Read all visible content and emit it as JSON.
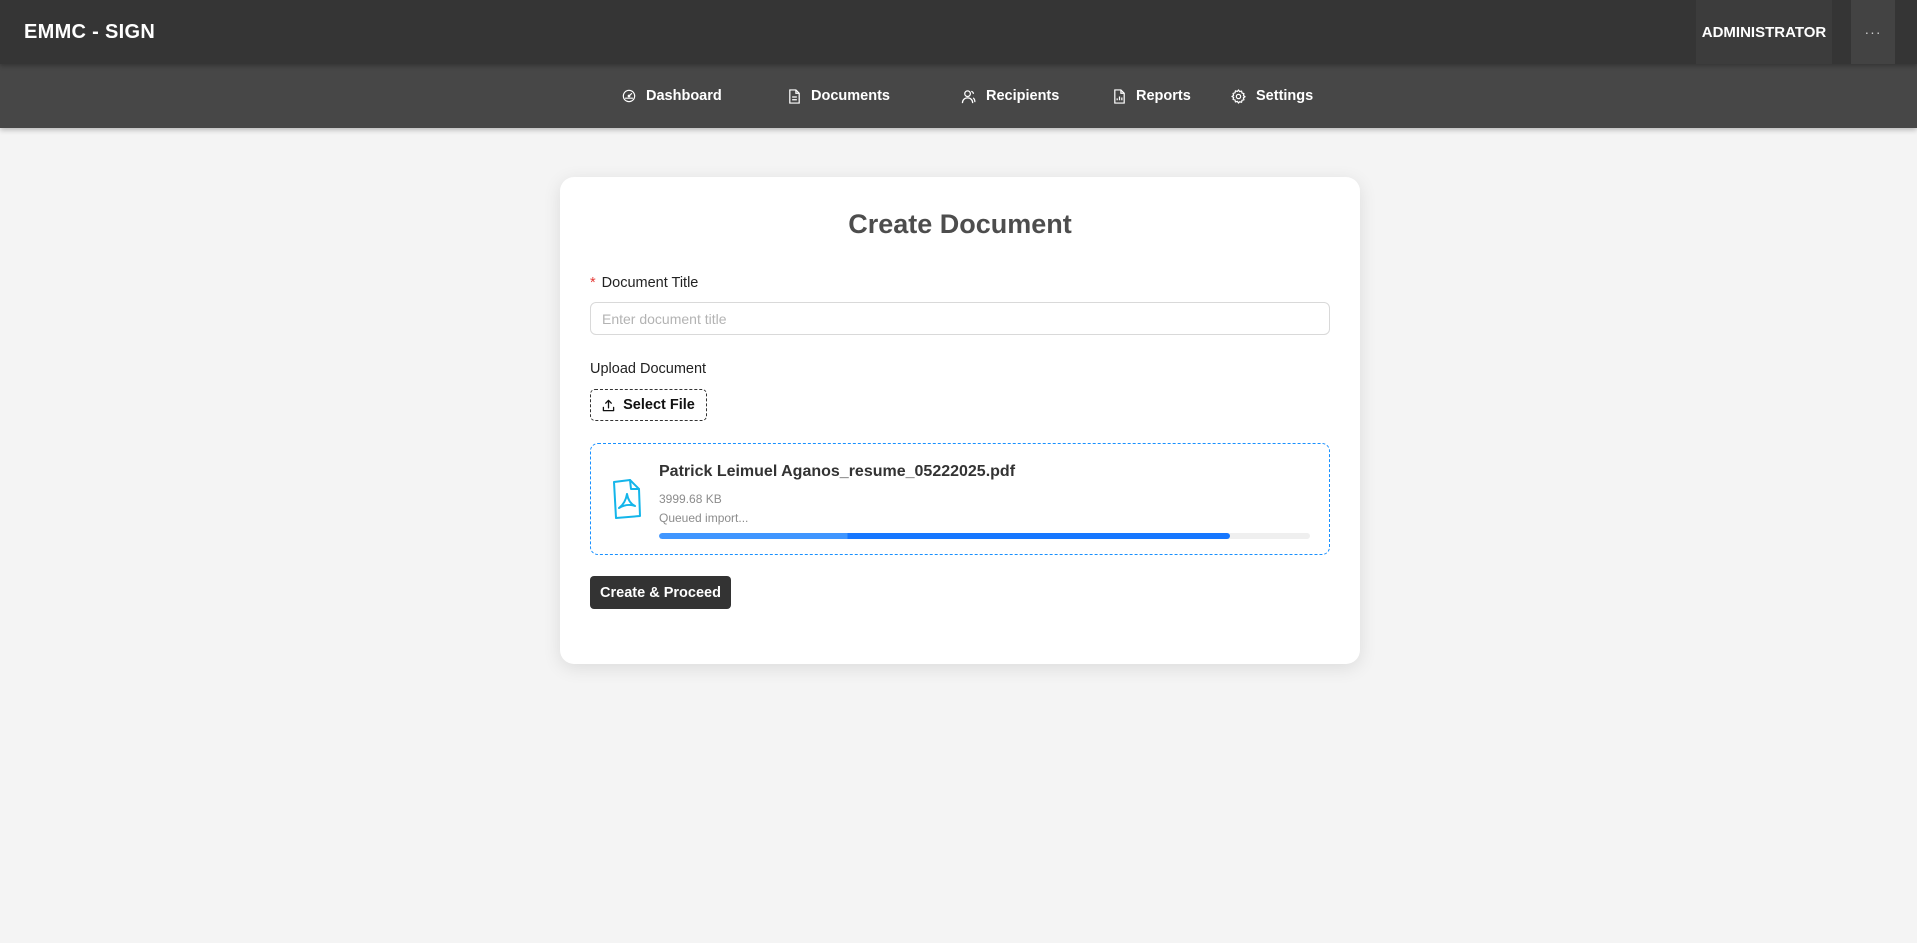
{
  "app": {
    "brand": "EMMC - SIGN",
    "user_label": "ADMINISTRATOR",
    "more_label": "···"
  },
  "nav": {
    "items": [
      {
        "label": "Dashboard",
        "icon": "dashboard-icon"
      },
      {
        "label": "Documents",
        "icon": "document-icon"
      },
      {
        "label": "Recipients",
        "icon": "recipients-icon"
      },
      {
        "label": "Reports",
        "icon": "report-icon"
      },
      {
        "label": "Settings",
        "icon": "gear-icon"
      }
    ]
  },
  "form": {
    "title": "Create Document",
    "required_marker": "*",
    "document_title_label": "Document Title",
    "document_title_value": "",
    "document_title_placeholder": "Enter document title",
    "upload_label": "Upload Document",
    "select_file_label": "Select File",
    "submit_label": "Create & Proceed"
  },
  "upload": {
    "file_name": "Patrick Leimuel Aganos_resume_05222025.pdf",
    "file_size": "3999.68 KB",
    "status": "Queued import...",
    "progress": 0.877,
    "file_icon": "pdf-file-icon"
  },
  "colors": {
    "header_bg": "#353535",
    "nav_bg": "#474747",
    "accent": "#1677ff",
    "pdf_icon": "#13b5ea",
    "primary_button": "#333333",
    "required": "#e53935"
  }
}
